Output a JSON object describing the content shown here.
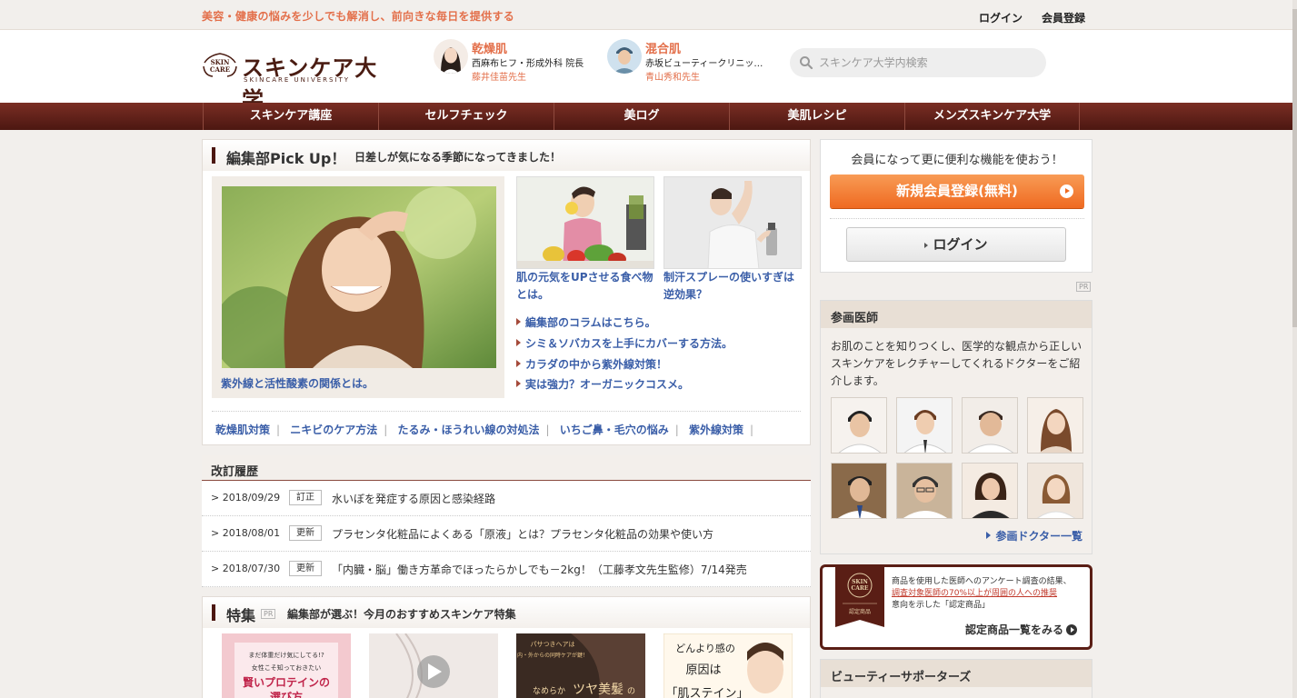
{
  "topbar": {
    "tagline": "美容・健康の悩みを少しでも解消し、前向きな毎日を提供する",
    "login": "ログイン",
    "register": "会員登録"
  },
  "logo": {
    "name": "スキンケア大学",
    "sub": "SKINCARE UNIVERSITY",
    "emblem_text_1": "SKIN",
    "emblem_text_2": "CARE"
  },
  "featured_doctors": [
    {
      "type": "乾燥肌",
      "clinic": "西麻布ヒフ・形成外科 院長",
      "name": "藤井佳苗先生"
    },
    {
      "type": "混合肌",
      "clinic": "赤坂ビューティークリニッ…",
      "name": "青山秀和先生"
    }
  ],
  "search": {
    "placeholder": "スキンケア大学内検索"
  },
  "nav": [
    "スキンケア講座",
    "セルフチェック",
    "美ログ",
    "美肌レシピ",
    "メンズスキンケア大学"
  ],
  "pickup": {
    "title": "編集部Pick Up！",
    "subtitle": "日差しが気になる季節になってきました！",
    "main_caption": "紫外線と活性酸素の関係とは。",
    "thumbs": [
      {
        "caption": "肌の元気をUPさせる食べ物とは。"
      },
      {
        "caption": "制汗スプレーの使いすぎは逆効果？"
      }
    ],
    "links": [
      "編集部のコラムはこちら。",
      "シミ＆ソバカスを上手にカバーする方法。",
      "カラダの中から紫外線対策！",
      "実は強力？オーガニックコスメ。"
    ],
    "tags": [
      "乾燥肌対策",
      "ニキビのケア方法",
      "たるみ・ほうれい線の対処法",
      "いちご鼻・毛穴の悩み",
      "紫外線対策"
    ]
  },
  "revisions": {
    "title": "改訂履歴",
    "rows": [
      {
        "date": "2018/09/29",
        "badge": "訂正",
        "text": "水いぼを発症する原因と感染経路"
      },
      {
        "date": "2018/08/01",
        "badge": "更新",
        "text": "プラセンタ化粧品によくある「原液」とは？プラセンタ化粧品の効果や使い方"
      },
      {
        "date": "2018/07/30",
        "badge": "更新",
        "text": "「内臓・脳」働き方革命でほったらかしでも－2kg！（工藤孝文先生監修）7/14発売"
      }
    ]
  },
  "tokushu": {
    "title": "特集",
    "pr": "PR",
    "subtitle": "編集部が選ぶ！今月のおすすめスキンケア特集",
    "thumb_texts": [
      "まだ体重だけ気にしてる!?",
      "女性こそ知っておきたい",
      "賢いプロテインの",
      "選び方",
      "パサつきヘアは",
      "内・外からの同時ケアが鍵！",
      "なめらか",
      "ツヤ美髪",
      "の",
      "どんより感の",
      "原因は",
      "「肌ステイン」"
    ]
  },
  "sidebar": {
    "reg_lead": "会員になって更に便利な機能を使おう！",
    "reg_button": "新規会員登録(無料)",
    "login_button": "ログイン",
    "pr": "PR",
    "doctors_title": "参画医師",
    "doctors_desc": "お肌のことを知りつくし、医学的な観点から正しいスキンケアをレクチャーしてくれるドクターをご紹介します。",
    "doctors_more": "参画ドクター一覧",
    "cert_text_1": "商品を使用した医師へのアンケート調査の結果、",
    "cert_text_red": "調査対象医師の70%以上が周囲の人への推奨",
    "cert_text_2": "意向を示した「認定商品」",
    "cert_emblem": "認定商品",
    "cert_link": "認定商品一覧をみる",
    "supporters_title": "ビューティーサポーターズ"
  }
}
